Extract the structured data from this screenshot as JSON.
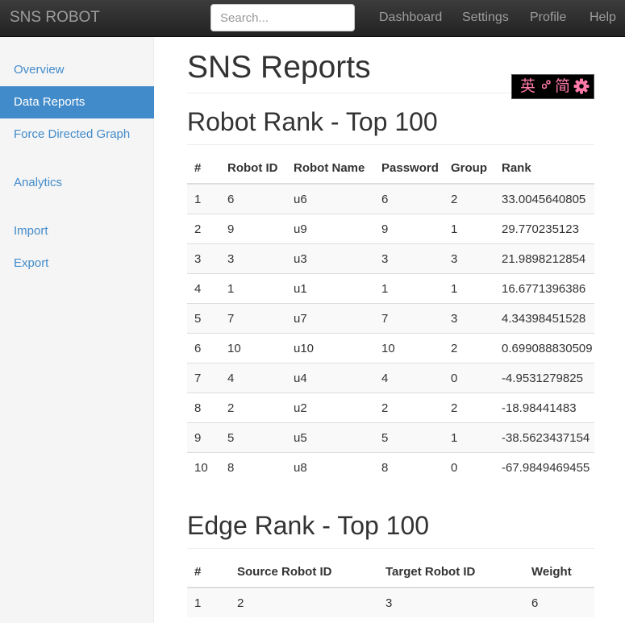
{
  "navbar": {
    "brand": "SNS ROBOT",
    "search_placeholder": "Search...",
    "links": [
      "Dashboard",
      "Settings",
      "Profile",
      "Help"
    ]
  },
  "sidebar": {
    "items": [
      "Overview",
      "Data Reports",
      "Force Directed Graph",
      "Analytics",
      "Import",
      "Export"
    ],
    "active": "Data Reports"
  },
  "page": {
    "title": "SNS Reports"
  },
  "lang_widget": {
    "left": "英",
    "middle": "简",
    "link_icon": "link-icon",
    "gear_icon": "gear-icon",
    "color": "#ff7aa9"
  },
  "robot_rank": {
    "title": "Robot Rank - Top 100",
    "columns": [
      "#",
      "Robot ID",
      "Robot Name",
      "Password",
      "Group",
      "Rank"
    ],
    "rows": [
      [
        "1",
        "6",
        "u6",
        "6",
        "2",
        "33.0045640805"
      ],
      [
        "2",
        "9",
        "u9",
        "9",
        "1",
        "29.770235123"
      ],
      [
        "3",
        "3",
        "u3",
        "3",
        "3",
        "21.9898212854"
      ],
      [
        "4",
        "1",
        "u1",
        "1",
        "1",
        "16.6771396386"
      ],
      [
        "5",
        "7",
        "u7",
        "7",
        "3",
        "4.34398451528"
      ],
      [
        "6",
        "10",
        "u10",
        "10",
        "2",
        "0.699088830509"
      ],
      [
        "7",
        "4",
        "u4",
        "4",
        "0",
        "-4.9531279825"
      ],
      [
        "8",
        "2",
        "u2",
        "2",
        "2",
        "-18.98441483"
      ],
      [
        "9",
        "5",
        "u5",
        "5",
        "1",
        "-38.5623437154"
      ],
      [
        "10",
        "8",
        "u8",
        "8",
        "0",
        "-67.9849469455"
      ]
    ]
  },
  "edge_rank": {
    "title": "Edge Rank - Top 100",
    "columns": [
      "#",
      "Source Robot ID",
      "Target Robot ID",
      "Weight"
    ],
    "rows": [
      [
        "1",
        "2",
        "3",
        "6"
      ]
    ]
  },
  "colors": {
    "accent": "#428bca",
    "navbar": "#222222"
  }
}
